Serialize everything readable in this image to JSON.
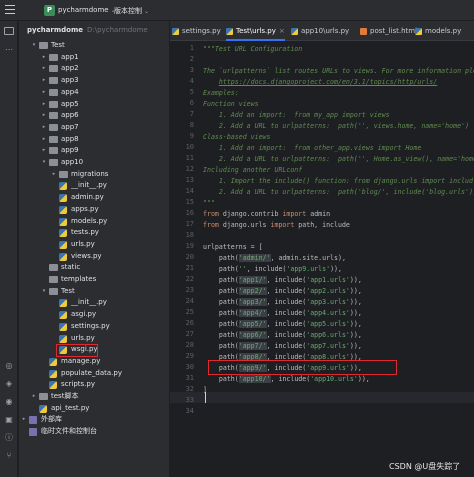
{
  "titlebar": {
    "project_badge": "P",
    "project_name": "pycharmdome",
    "vcs_label": "版本控制",
    "chevron": "⌄"
  },
  "project_panel": {
    "header": "pycharmdome",
    "header_suffix": "D:\\pycharmdome"
  },
  "tree": [
    {
      "label": "Test",
      "depth": 1,
      "type": "dir",
      "arrow": "▾"
    },
    {
      "label": "app1",
      "depth": 2,
      "type": "dir",
      "arrow": "▸"
    },
    {
      "label": "app2",
      "depth": 2,
      "type": "dir",
      "arrow": "▸"
    },
    {
      "label": "app3",
      "depth": 2,
      "type": "dir",
      "arrow": "▸"
    },
    {
      "label": "app4",
      "depth": 2,
      "type": "dir",
      "arrow": "▸"
    },
    {
      "label": "app5",
      "depth": 2,
      "type": "dir",
      "arrow": "▸"
    },
    {
      "label": "app6",
      "depth": 2,
      "type": "dir",
      "arrow": "▸"
    },
    {
      "label": "app7",
      "depth": 2,
      "type": "dir",
      "arrow": "▸"
    },
    {
      "label": "app8",
      "depth": 2,
      "type": "dir",
      "arrow": "▸"
    },
    {
      "label": "app9",
      "depth": 2,
      "type": "dir",
      "arrow": "▸"
    },
    {
      "label": "app10",
      "depth": 2,
      "type": "dir",
      "arrow": "▾"
    },
    {
      "label": "migrations",
      "depth": 3,
      "type": "dir",
      "arrow": "▸"
    },
    {
      "label": "__init__.py",
      "depth": 3,
      "type": "py",
      "arrow": ""
    },
    {
      "label": "admin.py",
      "depth": 3,
      "type": "py",
      "arrow": ""
    },
    {
      "label": "apps.py",
      "depth": 3,
      "type": "py",
      "arrow": ""
    },
    {
      "label": "models.py",
      "depth": 3,
      "type": "py",
      "arrow": ""
    },
    {
      "label": "tests.py",
      "depth": 3,
      "type": "py",
      "arrow": ""
    },
    {
      "label": "urls.py",
      "depth": 3,
      "type": "py",
      "arrow": ""
    },
    {
      "label": "views.py",
      "depth": 3,
      "type": "py",
      "arrow": ""
    },
    {
      "label": "static",
      "depth": 2,
      "type": "dir",
      "arrow": ""
    },
    {
      "label": "templates",
      "depth": 2,
      "type": "dir",
      "arrow": ""
    },
    {
      "label": "Test",
      "depth": 2,
      "type": "dir",
      "arrow": "▾"
    },
    {
      "label": "__init__.py",
      "depth": 3,
      "type": "py",
      "arrow": ""
    },
    {
      "label": "asgi.py",
      "depth": 3,
      "type": "py",
      "arrow": ""
    },
    {
      "label": "settings.py",
      "depth": 3,
      "type": "py",
      "arrow": ""
    },
    {
      "label": "urls.py",
      "depth": 3,
      "type": "py",
      "arrow": ""
    },
    {
      "label": "wsgi.py",
      "depth": 3,
      "type": "py",
      "arrow": ""
    },
    {
      "label": "manage.py",
      "depth": 2,
      "type": "py",
      "arrow": ""
    },
    {
      "label": "populate_data.py",
      "depth": 2,
      "type": "py",
      "arrow": ""
    },
    {
      "label": "scripts.py",
      "depth": 2,
      "type": "py",
      "arrow": ""
    },
    {
      "label": "test脚本",
      "depth": 1,
      "type": "dir",
      "arrow": "▸"
    },
    {
      "label": "api_test.py",
      "depth": 1,
      "type": "py",
      "arrow": ""
    },
    {
      "label": "外部库",
      "depth": 0,
      "type": "misc",
      "arrow": "▸"
    },
    {
      "label": "临时文件和控制台",
      "depth": 0,
      "type": "misc",
      "arrow": ""
    }
  ],
  "tabs": [
    {
      "label": "settings.py",
      "kind": "py",
      "active": false
    },
    {
      "label": "Test\\urls.py",
      "kind": "py",
      "active": true
    },
    {
      "label": "app10\\urls.py",
      "kind": "py",
      "active": false
    },
    {
      "label": "post_list.html",
      "kind": "html",
      "active": false
    },
    {
      "label": "models.py",
      "kind": "py",
      "active": false
    }
  ],
  "code": [
    {
      "n": "1",
      "parts": [
        [
          "doc",
          "\"\"\"Test URL Configuration"
        ]
      ]
    },
    {
      "n": "2",
      "parts": []
    },
    {
      "n": "3",
      "parts": [
        [
          "doc",
          "The `urlpatterns` list routes URLs to views. For more information ple"
        ]
      ]
    },
    {
      "n": "4",
      "parts": [
        [
          "doc",
          "    "
        ],
        [
          "url",
          "https://docs.djangoproject.com/en/3.1/topics/http/urls/"
        ]
      ]
    },
    {
      "n": "5",
      "parts": [
        [
          "doc",
          "Examples:"
        ]
      ]
    },
    {
      "n": "6",
      "parts": [
        [
          "doc",
          "Function views"
        ]
      ]
    },
    {
      "n": "7",
      "parts": [
        [
          "doc",
          "    1. Add an import:  from my_app import views"
        ]
      ]
    },
    {
      "n": "8",
      "parts": [
        [
          "doc",
          "    2. Add a URL to urlpatterns:  path('', views.home, name='home')"
        ]
      ]
    },
    {
      "n": "9",
      "parts": [
        [
          "doc",
          "Class-based views"
        ]
      ]
    },
    {
      "n": "10",
      "parts": [
        [
          "doc",
          "    1. Add an import:  from other_app.views import Home"
        ]
      ]
    },
    {
      "n": "11",
      "parts": [
        [
          "doc",
          "    2. Add a URL to urlpatterns:  path('', Home.as_view(), name='home"
        ]
      ]
    },
    {
      "n": "12",
      "parts": [
        [
          "doc",
          "Including another URLconf"
        ]
      ]
    },
    {
      "n": "13",
      "parts": [
        [
          "doc",
          "    1. Import the include() function: from django.urls import includ"
        ]
      ]
    },
    {
      "n": "14",
      "parts": [
        [
          "doc",
          "    2. Add a URL to urlpatterns:  path('blog/', include('blog.urls'))"
        ]
      ]
    },
    {
      "n": "15",
      "parts": [
        [
          "doc",
          "\"\"\""
        ]
      ]
    },
    {
      "n": "16",
      "parts": [
        [
          "kw",
          "from"
        ],
        [
          "plain",
          " django.contrib "
        ],
        [
          "kw",
          "import"
        ],
        [
          "plain",
          " admin"
        ]
      ]
    },
    {
      "n": "17",
      "parts": [
        [
          "kw",
          "from"
        ],
        [
          "plain",
          " django.urls "
        ],
        [
          "kw",
          "import"
        ],
        [
          "plain",
          " path, include"
        ]
      ]
    },
    {
      "n": "18",
      "parts": []
    },
    {
      "n": "19",
      "parts": [
        [
          "plain",
          "urlpatterns = ["
        ]
      ]
    },
    {
      "n": "20",
      "parts": [
        [
          "plain",
          "    path("
        ],
        [
          "hlstr",
          "'admin/'"
        ],
        [
          "plain",
          ", admin.site.urls),"
        ]
      ]
    },
    {
      "n": "21",
      "parts": [
        [
          "plain",
          "    path("
        ],
        [
          "str",
          "''"
        ],
        [
          "plain",
          ", include("
        ],
        [
          "str",
          "'app9.urls'"
        ],
        [
          "plain",
          ")),"
        ]
      ]
    },
    {
      "n": "22",
      "parts": [
        [
          "plain",
          "    path("
        ],
        [
          "hlstr",
          "'app1/'"
        ],
        [
          "plain",
          ", include("
        ],
        [
          "str",
          "'app1.urls'"
        ],
        [
          "plain",
          ")),"
        ]
      ]
    },
    {
      "n": "23",
      "parts": [
        [
          "plain",
          "    path("
        ],
        [
          "hlstr",
          "'app2/'"
        ],
        [
          "plain",
          ", include("
        ],
        [
          "str",
          "'app2.urls'"
        ],
        [
          "plain",
          ")),"
        ]
      ]
    },
    {
      "n": "24",
      "parts": [
        [
          "plain",
          "    path("
        ],
        [
          "hlstr",
          "'app3/'"
        ],
        [
          "plain",
          ", include("
        ],
        [
          "str",
          "'app3.urls'"
        ],
        [
          "plain",
          ")),"
        ]
      ]
    },
    {
      "n": "25",
      "parts": [
        [
          "plain",
          "    path("
        ],
        [
          "hlstr",
          "'app4/'"
        ],
        [
          "plain",
          ", include("
        ],
        [
          "str",
          "'app4.urls'"
        ],
        [
          "plain",
          ")),"
        ]
      ]
    },
    {
      "n": "26",
      "parts": [
        [
          "plain",
          "    path("
        ],
        [
          "hlstr",
          "'app5/'"
        ],
        [
          "plain",
          ", include("
        ],
        [
          "str",
          "'app5.urls'"
        ],
        [
          "plain",
          ")),"
        ]
      ]
    },
    {
      "n": "27",
      "parts": [
        [
          "plain",
          "    path("
        ],
        [
          "hlstr",
          "'app6/'"
        ],
        [
          "plain",
          ", include("
        ],
        [
          "str",
          "'app6.urls'"
        ],
        [
          "plain",
          ")),"
        ]
      ]
    },
    {
      "n": "28",
      "parts": [
        [
          "plain",
          "    path("
        ],
        [
          "hlstr",
          "'app7/'"
        ],
        [
          "plain",
          ", include("
        ],
        [
          "str",
          "'app7.urls'"
        ],
        [
          "plain",
          ")),"
        ]
      ]
    },
    {
      "n": "29",
      "parts": [
        [
          "plain",
          "    path("
        ],
        [
          "hlstr",
          "'app8/'"
        ],
        [
          "plain",
          ", include("
        ],
        [
          "str",
          "'app8.urls'"
        ],
        [
          "plain",
          ")),"
        ]
      ]
    },
    {
      "n": "30",
      "parts": [
        [
          "plain",
          "    path("
        ],
        [
          "hlstr",
          "'app9/'"
        ],
        [
          "plain",
          ", include("
        ],
        [
          "str",
          "'app9.urls'"
        ],
        [
          "plain",
          ")),"
        ]
      ]
    },
    {
      "n": "31",
      "parts": [
        [
          "plain",
          "    path("
        ],
        [
          "hlstr",
          "'app10/'"
        ],
        [
          "plain",
          ", include("
        ],
        [
          "str",
          "'app10.urls'"
        ],
        [
          "plain",
          ")),"
        ]
      ]
    },
    {
      "n": "32",
      "parts": [
        [
          "plain",
          "]"
        ]
      ]
    },
    {
      "n": "33",
      "parts": []
    },
    {
      "n": "34",
      "parts": []
    }
  ],
  "watermark": "CSDN @U盘失踪了",
  "colors": {
    "accent": "#3574f0",
    "highlight_box": "#e0282d",
    "keyword": "#cf8e6d",
    "string": "#6aab73",
    "docstring": "#5f8c4f"
  }
}
